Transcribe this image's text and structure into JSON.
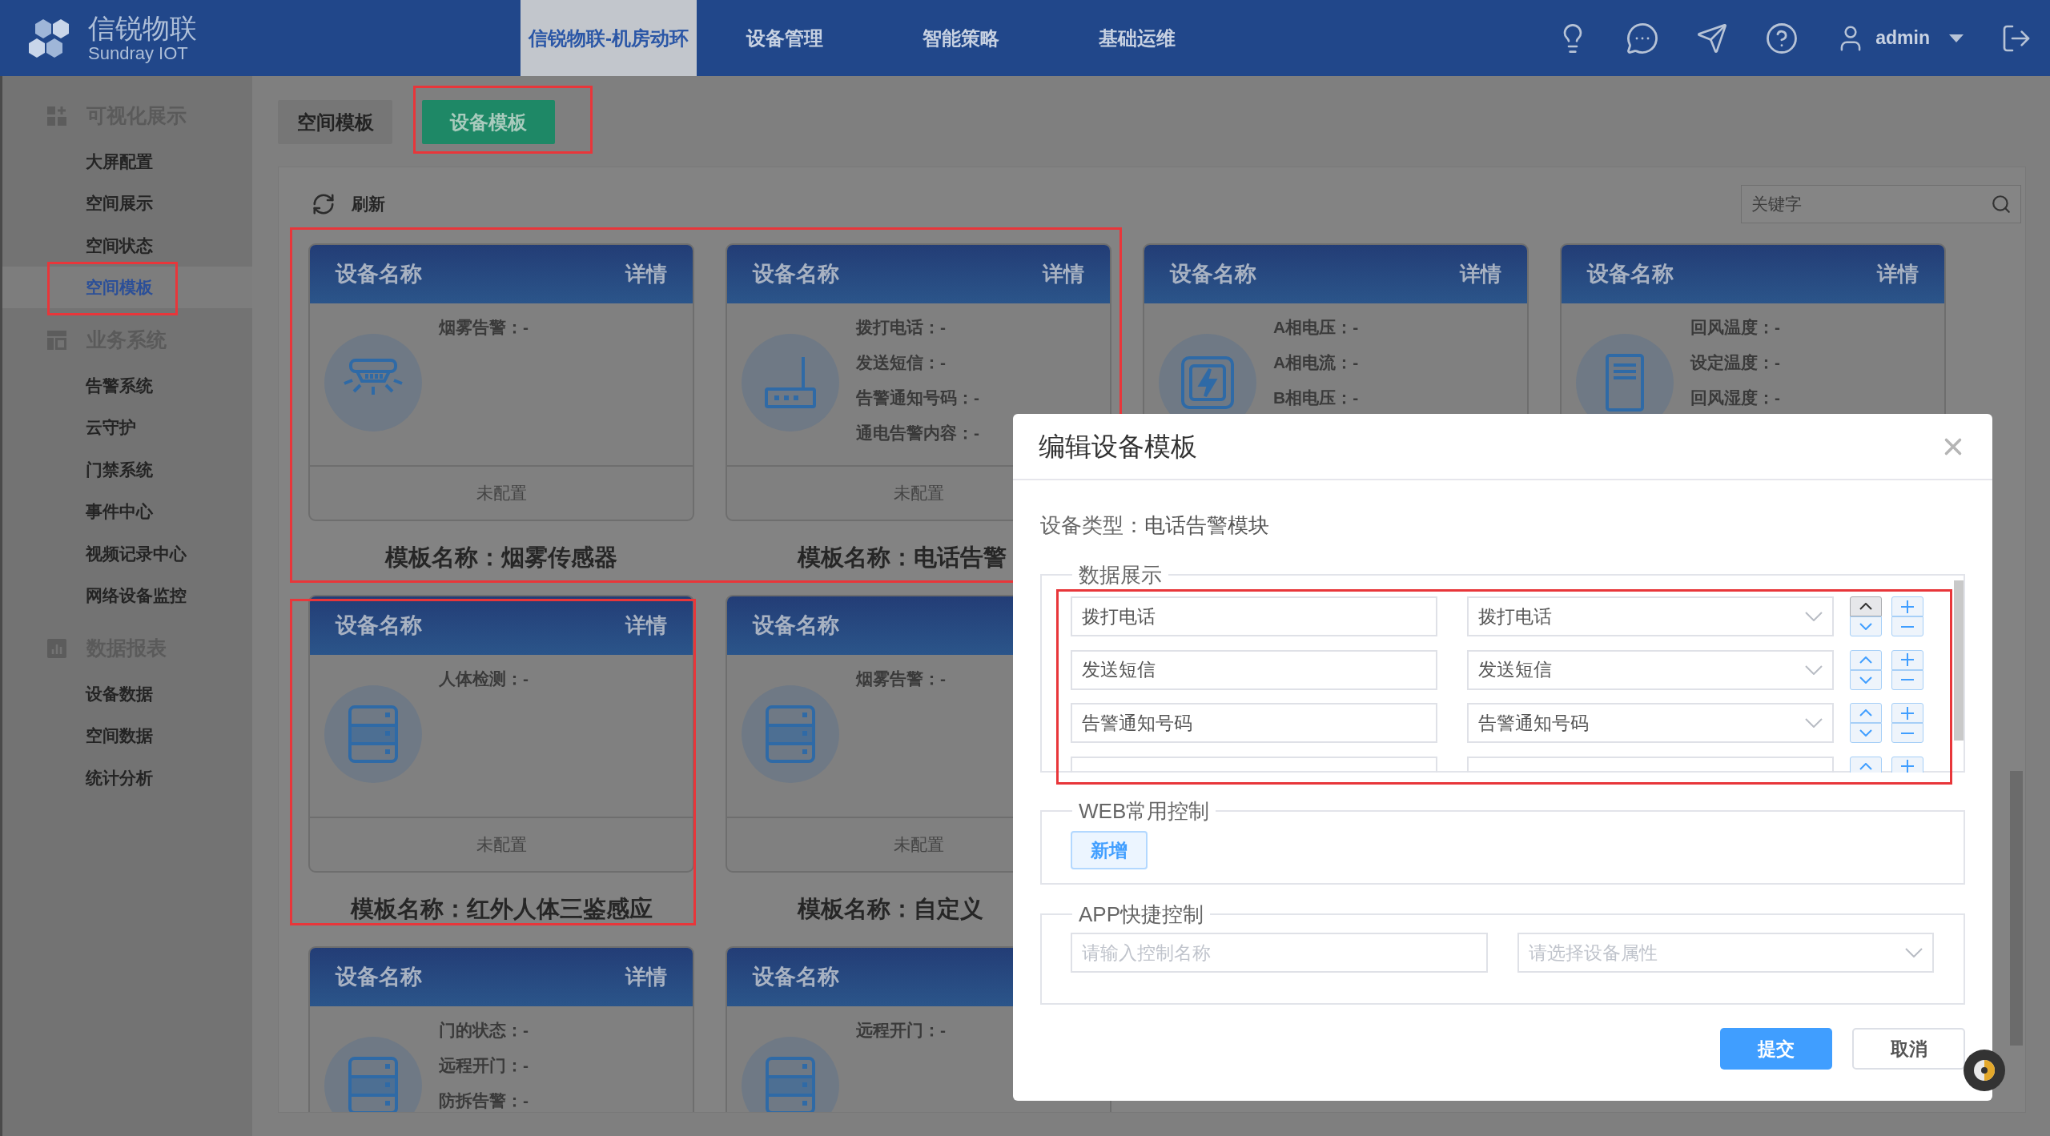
{
  "logo": {
    "name": "信锐物联",
    "subtitle": "Sundray IOT"
  },
  "nav": [
    {
      "label": "信锐物联-机房动环",
      "selected": true
    },
    {
      "label": "设备管理",
      "selected": false
    },
    {
      "label": "智能策略",
      "selected": false
    },
    {
      "label": "基础运维",
      "selected": false
    }
  ],
  "user": {
    "name": "admin"
  },
  "sidebar": [
    {
      "title": "可视化展示",
      "items": [
        {
          "label": "大屏配置",
          "selected": false
        },
        {
          "label": "空间展示",
          "selected": false
        },
        {
          "label": "空间状态",
          "selected": false
        },
        {
          "label": "空间模板",
          "selected": true
        }
      ]
    },
    {
      "title": "业务系统",
      "items": [
        {
          "label": "告警系统",
          "selected": false
        },
        {
          "label": "云守护",
          "selected": false
        },
        {
          "label": "门禁系统",
          "selected": false
        },
        {
          "label": "事件中心",
          "selected": false
        },
        {
          "label": "视频记录中心",
          "selected": false
        },
        {
          "label": "网络设备监控",
          "selected": false
        }
      ]
    },
    {
      "title": "数据报表",
      "items": [
        {
          "label": "设备数据",
          "selected": false
        },
        {
          "label": "空间数据",
          "selected": false
        },
        {
          "label": "统计分析",
          "selected": false
        }
      ]
    }
  ],
  "tabs": [
    {
      "label": "空间模板",
      "selected": false
    },
    {
      "label": "设备模板",
      "selected": true
    }
  ],
  "toolbar": {
    "refresh": "刷新",
    "search_placeholder": "关键字"
  },
  "card_rows": [
    {
      "cards": [
        {
          "kind": "smoke",
          "header": "设备名称",
          "detail": "详情",
          "fields": [
            "烟雾告警：-"
          ],
          "status": "未配置",
          "template_name": "模板名称：烟雾传感器"
        },
        {
          "kind": "router",
          "header": "设备名称",
          "detail": "详情",
          "fields": [
            "拨打电话：-",
            "发送短信：-",
            "告警通知号码：-",
            "通电告警内容：-"
          ],
          "status": "未配置",
          "template_name": "模板名称：电话告警"
        },
        {
          "kind": "power",
          "header": "设备名称",
          "detail": "详情",
          "fields": [
            "A相电压：-",
            "A相电流：-",
            "B相电压：-"
          ]
        },
        {
          "kind": "cabinet",
          "header": "设备名称",
          "detail": "详情",
          "fields": [
            "回风温度：-",
            "设定温度：-",
            "回风湿度：-"
          ]
        }
      ]
    },
    {
      "cards": [
        {
          "kind": "server",
          "header": "设备名称",
          "detail": "详情",
          "fields": [
            "人体检测：-"
          ],
          "status": "未配置",
          "template_name": "模板名称：红外人体三鉴感应"
        },
        {
          "kind": "server",
          "header": "设备名称",
          "fields": [
            "烟雾告警：-"
          ],
          "status": "未配置",
          "template_name": "模板名称：自定义"
        }
      ]
    },
    {
      "cards": [
        {
          "kind": "server",
          "header": "设备名称",
          "detail": "详情",
          "fields": [
            "门的状态：-",
            "远程开门：-",
            "防拆告警：-"
          ]
        },
        {
          "kind": "server",
          "header": "设备名称",
          "fields": [
            "远程开门：-"
          ]
        }
      ]
    }
  ],
  "modal": {
    "title": "编辑设备模板",
    "type_label": "设备类型：",
    "type_value": "电话告警模块",
    "data_section": {
      "legend": "数据展示",
      "rows": [
        {
          "kind": "row",
          "name": "拨打电话",
          "attribute": "拨打电话",
          "up_hovered": true
        },
        {
          "kind": "row",
          "name": "发送短信",
          "attribute": "发送短信",
          "up_hovered": false
        },
        {
          "kind": "row",
          "name": "告警通知号码",
          "attribute": "告警通知号码",
          "up_hovered": false
        },
        {
          "kind": "partial",
          "up_hovered": false
        }
      ]
    },
    "web_section": {
      "legend": "WEB常用控制",
      "add_button": "新增"
    },
    "app_section": {
      "legend": "APP快捷控制",
      "name_placeholder": "请输入控制名称",
      "attribute_placeholder": "请选择设备属性"
    },
    "submit": "提交",
    "cancel": "取消"
  }
}
